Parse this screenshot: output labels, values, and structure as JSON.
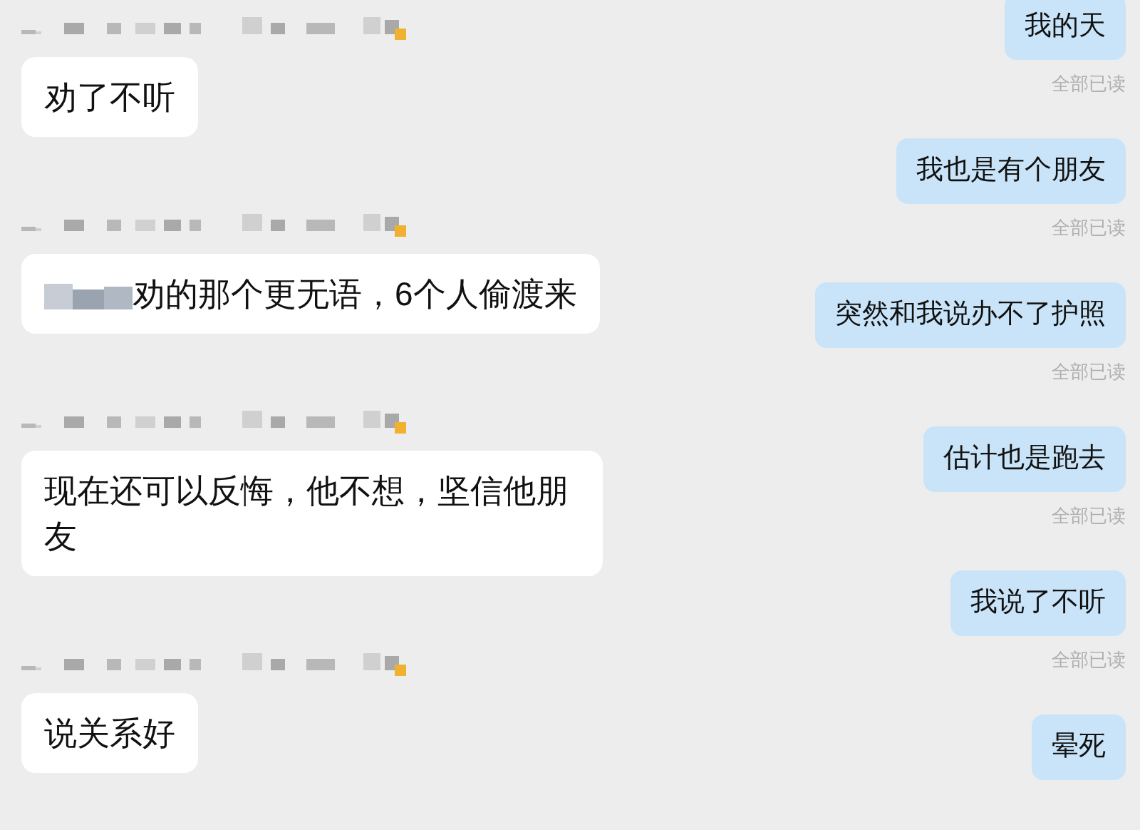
{
  "incoming_messages": [
    {
      "text": "劝了不听",
      "blurred_prefix": false
    },
    {
      "text": "劝的那个更无语，6个人偷渡来",
      "blurred_prefix": true
    },
    {
      "text": "现在还可以反悔，他不想，坚信他朋友",
      "blurred_prefix": false
    },
    {
      "text": "说关系好",
      "blurred_prefix": false
    }
  ],
  "outgoing_messages": [
    {
      "text": "我的天",
      "status": "全部已读"
    },
    {
      "text": "我也是有个朋友",
      "status": "全部已读"
    },
    {
      "text": "突然和我说办不了护照",
      "status": "全部已读"
    },
    {
      "text": "估计也是跑去",
      "status": "全部已读"
    },
    {
      "text": "我说了不听",
      "status": "全部已读"
    },
    {
      "text": "晕死"
    }
  ]
}
